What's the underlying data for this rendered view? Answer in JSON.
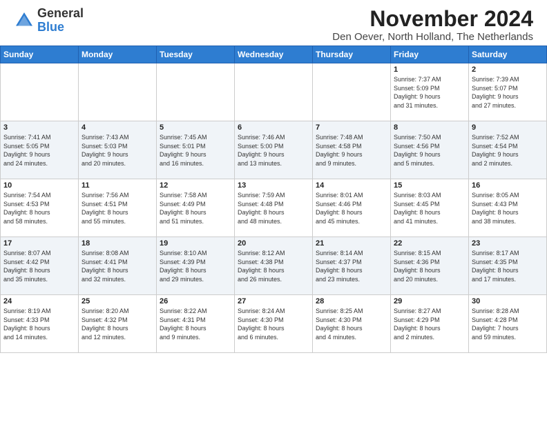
{
  "header": {
    "logo": {
      "general": "General",
      "blue": "Blue"
    },
    "month": "November 2024",
    "location": "Den Oever, North Holland, The Netherlands"
  },
  "days_of_week": [
    "Sunday",
    "Monday",
    "Tuesday",
    "Wednesday",
    "Thursday",
    "Friday",
    "Saturday"
  ],
  "weeks": [
    [
      {
        "day": "",
        "info": ""
      },
      {
        "day": "",
        "info": ""
      },
      {
        "day": "",
        "info": ""
      },
      {
        "day": "",
        "info": ""
      },
      {
        "day": "",
        "info": ""
      },
      {
        "day": "1",
        "info": "Sunrise: 7:37 AM\nSunset: 5:09 PM\nDaylight: 9 hours\nand 31 minutes."
      },
      {
        "day": "2",
        "info": "Sunrise: 7:39 AM\nSunset: 5:07 PM\nDaylight: 9 hours\nand 27 minutes."
      }
    ],
    [
      {
        "day": "3",
        "info": "Sunrise: 7:41 AM\nSunset: 5:05 PM\nDaylight: 9 hours\nand 24 minutes."
      },
      {
        "day": "4",
        "info": "Sunrise: 7:43 AM\nSunset: 5:03 PM\nDaylight: 9 hours\nand 20 minutes."
      },
      {
        "day": "5",
        "info": "Sunrise: 7:45 AM\nSunset: 5:01 PM\nDaylight: 9 hours\nand 16 minutes."
      },
      {
        "day": "6",
        "info": "Sunrise: 7:46 AM\nSunset: 5:00 PM\nDaylight: 9 hours\nand 13 minutes."
      },
      {
        "day": "7",
        "info": "Sunrise: 7:48 AM\nSunset: 4:58 PM\nDaylight: 9 hours\nand 9 minutes."
      },
      {
        "day": "8",
        "info": "Sunrise: 7:50 AM\nSunset: 4:56 PM\nDaylight: 9 hours\nand 5 minutes."
      },
      {
        "day": "9",
        "info": "Sunrise: 7:52 AM\nSunset: 4:54 PM\nDaylight: 9 hours\nand 2 minutes."
      }
    ],
    [
      {
        "day": "10",
        "info": "Sunrise: 7:54 AM\nSunset: 4:53 PM\nDaylight: 8 hours\nand 58 minutes."
      },
      {
        "day": "11",
        "info": "Sunrise: 7:56 AM\nSunset: 4:51 PM\nDaylight: 8 hours\nand 55 minutes."
      },
      {
        "day": "12",
        "info": "Sunrise: 7:58 AM\nSunset: 4:49 PM\nDaylight: 8 hours\nand 51 minutes."
      },
      {
        "day": "13",
        "info": "Sunrise: 7:59 AM\nSunset: 4:48 PM\nDaylight: 8 hours\nand 48 minutes."
      },
      {
        "day": "14",
        "info": "Sunrise: 8:01 AM\nSunset: 4:46 PM\nDaylight: 8 hours\nand 45 minutes."
      },
      {
        "day": "15",
        "info": "Sunrise: 8:03 AM\nSunset: 4:45 PM\nDaylight: 8 hours\nand 41 minutes."
      },
      {
        "day": "16",
        "info": "Sunrise: 8:05 AM\nSunset: 4:43 PM\nDaylight: 8 hours\nand 38 minutes."
      }
    ],
    [
      {
        "day": "17",
        "info": "Sunrise: 8:07 AM\nSunset: 4:42 PM\nDaylight: 8 hours\nand 35 minutes."
      },
      {
        "day": "18",
        "info": "Sunrise: 8:08 AM\nSunset: 4:41 PM\nDaylight: 8 hours\nand 32 minutes."
      },
      {
        "day": "19",
        "info": "Sunrise: 8:10 AM\nSunset: 4:39 PM\nDaylight: 8 hours\nand 29 minutes."
      },
      {
        "day": "20",
        "info": "Sunrise: 8:12 AM\nSunset: 4:38 PM\nDaylight: 8 hours\nand 26 minutes."
      },
      {
        "day": "21",
        "info": "Sunrise: 8:14 AM\nSunset: 4:37 PM\nDaylight: 8 hours\nand 23 minutes."
      },
      {
        "day": "22",
        "info": "Sunrise: 8:15 AM\nSunset: 4:36 PM\nDaylight: 8 hours\nand 20 minutes."
      },
      {
        "day": "23",
        "info": "Sunrise: 8:17 AM\nSunset: 4:35 PM\nDaylight: 8 hours\nand 17 minutes."
      }
    ],
    [
      {
        "day": "24",
        "info": "Sunrise: 8:19 AM\nSunset: 4:33 PM\nDaylight: 8 hours\nand 14 minutes."
      },
      {
        "day": "25",
        "info": "Sunrise: 8:20 AM\nSunset: 4:32 PM\nDaylight: 8 hours\nand 12 minutes."
      },
      {
        "day": "26",
        "info": "Sunrise: 8:22 AM\nSunset: 4:31 PM\nDaylight: 8 hours\nand 9 minutes."
      },
      {
        "day": "27",
        "info": "Sunrise: 8:24 AM\nSunset: 4:30 PM\nDaylight: 8 hours\nand 6 minutes."
      },
      {
        "day": "28",
        "info": "Sunrise: 8:25 AM\nSunset: 4:30 PM\nDaylight: 8 hours\nand 4 minutes."
      },
      {
        "day": "29",
        "info": "Sunrise: 8:27 AM\nSunset: 4:29 PM\nDaylight: 8 hours\nand 2 minutes."
      },
      {
        "day": "30",
        "info": "Sunrise: 8:28 AM\nSunset: 4:28 PM\nDaylight: 7 hours\nand 59 minutes."
      }
    ]
  ]
}
